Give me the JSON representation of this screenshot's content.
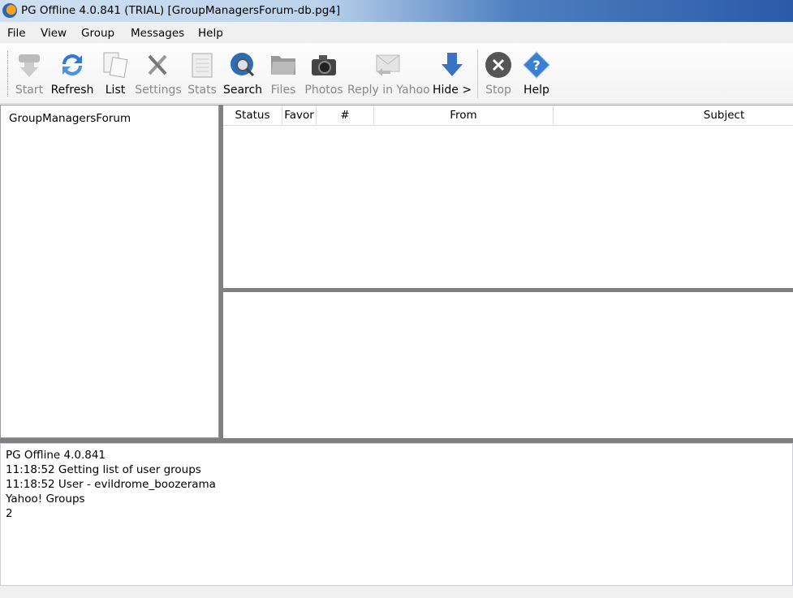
{
  "window": {
    "title": "PG Offline 4.0.841 (TRIAL) [GroupManagersForum-db.pg4]"
  },
  "menu": [
    "File",
    "View",
    "Group",
    "Messages",
    "Help"
  ],
  "toolbar": [
    {
      "label": "Start",
      "icon": "start-icon",
      "enabled": false
    },
    {
      "label": "Refresh",
      "icon": "refresh-icon",
      "enabled": true
    },
    {
      "label": "List",
      "icon": "list-icon",
      "enabled": true
    },
    {
      "label": "Settings",
      "icon": "settings-icon",
      "enabled": false
    },
    {
      "label": "Stats",
      "icon": "stats-icon",
      "enabled": false
    },
    {
      "label": "Search",
      "icon": "search-icon",
      "enabled": true
    },
    {
      "label": "Files",
      "icon": "folder-icon",
      "enabled": false
    },
    {
      "label": "Photos",
      "icon": "camera-icon",
      "enabled": false
    },
    {
      "label": "Reply in Yahoo",
      "icon": "reply-icon",
      "enabled": false
    },
    {
      "label": "Hide >",
      "icon": "arrow-down-icon",
      "enabled": true
    },
    {
      "label": "Stop",
      "icon": "stop-icon",
      "enabled": false
    },
    {
      "label": "Help",
      "icon": "help-icon",
      "enabled": true
    }
  ],
  "tree": {
    "items": [
      "GroupManagersForum"
    ]
  },
  "list": {
    "columns": [
      "Status",
      "Favor",
      "#",
      "From",
      "Subject"
    ]
  },
  "log": {
    "lines": [
      "PG Offline 4.0.841",
      "11:18:52 Getting list of user groups",
      "11:18:52 User - evildrome_boozerama",
      "Yahoo! Groups",
      "2"
    ]
  }
}
